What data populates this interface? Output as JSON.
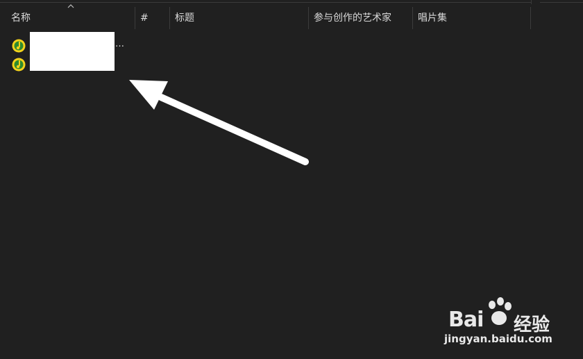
{
  "header": {
    "columns": [
      "名称",
      "#",
      "标题",
      "参与创作的艺术家",
      "唱片集"
    ]
  },
  "rows": [
    {
      "name": "…",
      "icon": "music-file-icon"
    },
    {
      "name": "",
      "icon": "music-file-icon"
    }
  ],
  "watermark": {
    "brand": "Bai",
    "suffix": "经验",
    "url": "jingyan.baidu.com"
  },
  "colors": {
    "background": "#202020",
    "icon_green": "#2e8b2e",
    "icon_yellow": "#f2d21b",
    "arrow": "#ffffff"
  }
}
